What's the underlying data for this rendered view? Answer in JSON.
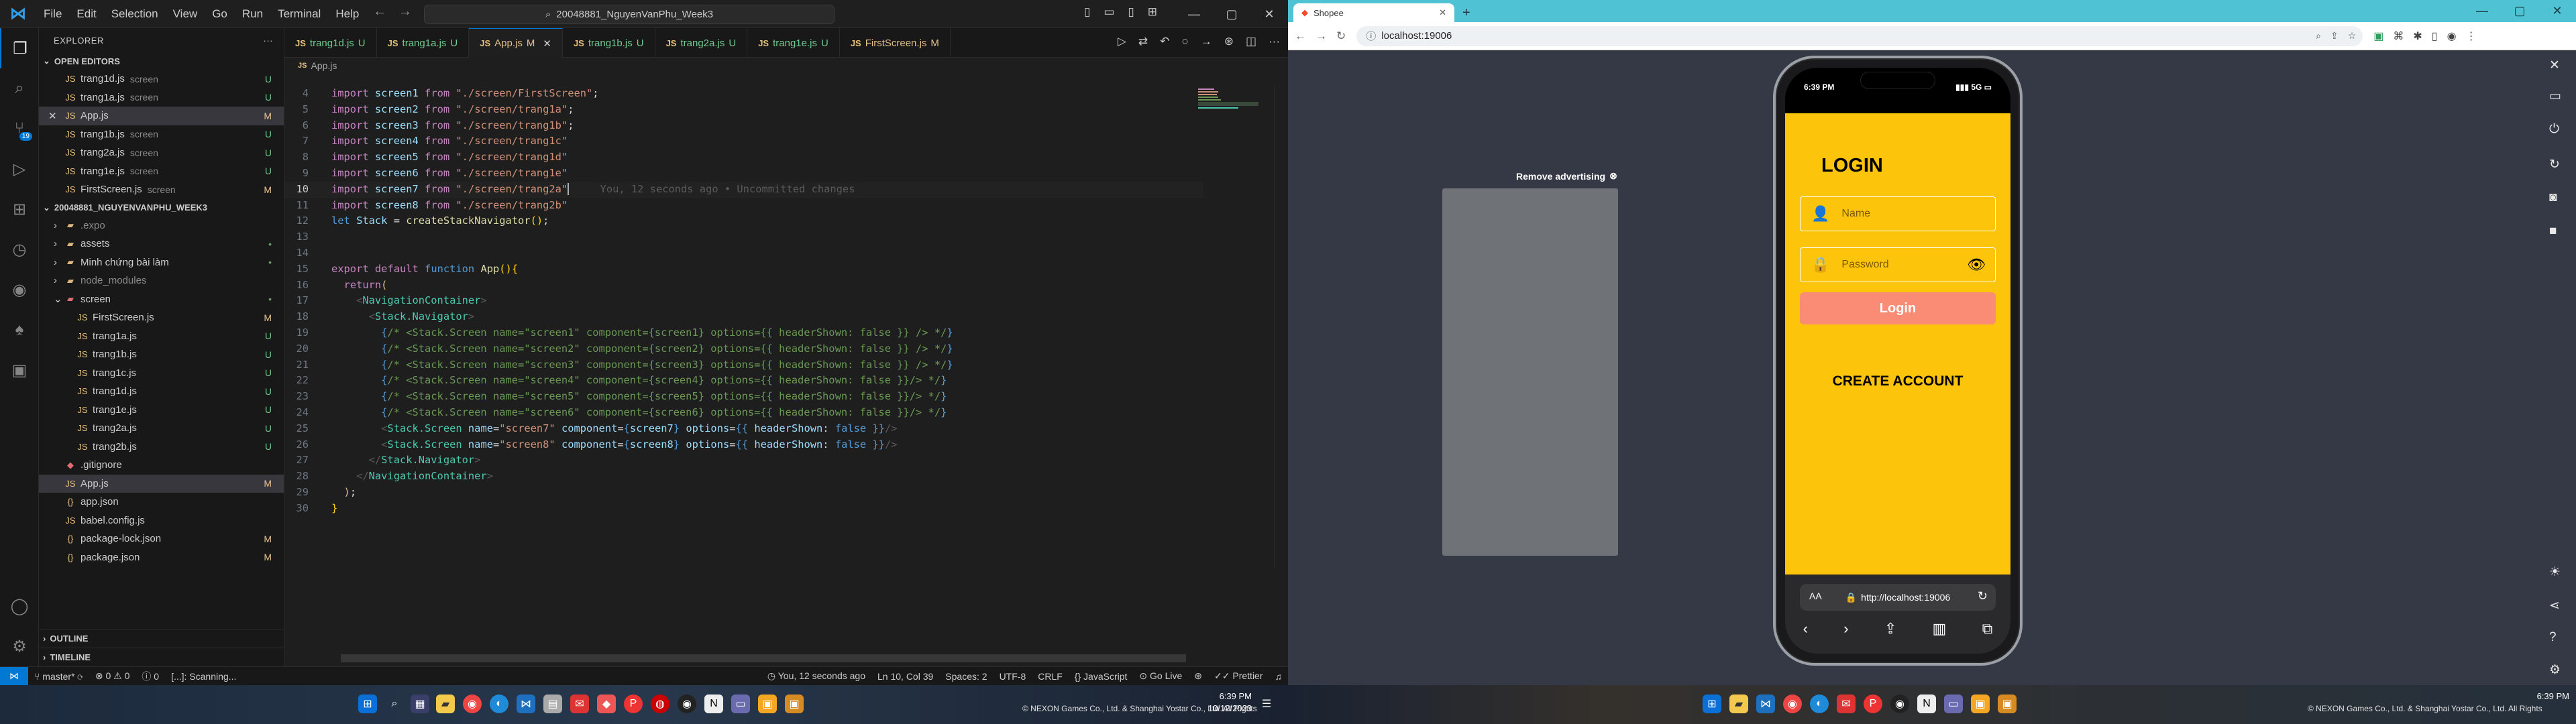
{
  "vscode": {
    "menu": [
      "File",
      "Edit",
      "Selection",
      "View",
      "Go",
      "Run",
      "Terminal",
      "Help"
    ],
    "search_title": "20048881_NguyenVanPhu_Week3",
    "explorer_label": "EXPLORER",
    "open_editors_label": "OPEN EDITORS",
    "open_editors": [
      {
        "name": "trang1d.js",
        "sub": "screen",
        "status": "U"
      },
      {
        "name": "trang1a.js",
        "sub": "screen",
        "status": "U"
      },
      {
        "name": "App.js",
        "sub": "",
        "status": "M"
      },
      {
        "name": "trang1b.js",
        "sub": "screen",
        "status": "U"
      },
      {
        "name": "trang2a.js",
        "sub": "screen",
        "status": "U"
      },
      {
        "name": "trang1e.js",
        "sub": "screen",
        "status": "U"
      },
      {
        "name": "FirstScreen.js",
        "sub": "screen",
        "status": "M"
      }
    ],
    "project_label": "20048881_NGUYENVANPHU_WEEK3",
    "tree": [
      {
        "name": ".expo",
        "type": "folder",
        "status": ""
      },
      {
        "name": "assets",
        "type": "folder",
        "status": "•"
      },
      {
        "name": "Minh chứng bài làm",
        "type": "folder",
        "status": "•"
      },
      {
        "name": "node_modules",
        "type": "folder",
        "status": ""
      },
      {
        "name": "screen",
        "type": "folder-open",
        "status": "•"
      },
      {
        "name": "FirstScreen.js",
        "type": "js",
        "status": "M"
      },
      {
        "name": "trang1a.js",
        "type": "js",
        "status": "U"
      },
      {
        "name": "trang1b.js",
        "type": "js",
        "status": "U"
      },
      {
        "name": "trang1c.js",
        "type": "js",
        "status": "U"
      },
      {
        "name": "trang1d.js",
        "type": "js",
        "status": "U"
      },
      {
        "name": "trang1e.js",
        "type": "js",
        "status": "U"
      },
      {
        "name": "trang2a.js",
        "type": "js",
        "status": "U"
      },
      {
        "name": "trang2b.js",
        "type": "js",
        "status": "U"
      },
      {
        "name": ".gitignore",
        "type": "git",
        "status": ""
      },
      {
        "name": "App.js",
        "type": "js",
        "status": "M"
      },
      {
        "name": "app.json",
        "type": "json",
        "status": ""
      },
      {
        "name": "babel.config.js",
        "type": "js",
        "status": ""
      },
      {
        "name": "package-lock.json",
        "type": "json",
        "status": "M"
      },
      {
        "name": "package.json",
        "type": "json",
        "status": "M"
      }
    ],
    "outline_label": "OUTLINE",
    "timeline_label": "TIMELINE",
    "tabs": [
      {
        "name": "trang1d.js",
        "status": "U"
      },
      {
        "name": "trang1a.js",
        "status": "U"
      },
      {
        "name": "App.js",
        "status": "M"
      },
      {
        "name": "trang1b.js",
        "status": "U"
      },
      {
        "name": "trang2a.js",
        "status": "U"
      },
      {
        "name": "trang1e.js",
        "status": "U"
      },
      {
        "name": "FirstScreen.js",
        "status": "M"
      }
    ],
    "breadcrumb": "App.js",
    "blame": "You, 12 seconds ago • Uncommitted changes",
    "status": {
      "branch": "master*",
      "errors": "0",
      "warnings": "0",
      "info": "0",
      "scanning": "[...]: Scanning...",
      "blame": "You, 12 seconds ago",
      "position": "Ln 10, Col 39",
      "spaces": "Spaces: 2",
      "encoding": "UTF-8",
      "eol": "CRLF",
      "language": "JavaScript",
      "golive": "Go Live",
      "prettier": "Prettier"
    }
  },
  "browser": {
    "tab_title": "Shopee",
    "url": "localhost:19006",
    "remove_ad": "Remove advertising",
    "phone": {
      "time": "6:39 PM",
      "signal": "5G",
      "login_title": "LOGIN",
      "name_placeholder": "Name",
      "password_placeholder": "Password",
      "login_button": "Login",
      "create_account": "CREATE ACCOUNT",
      "safari_url": "http://localhost:19006",
      "safari_aa": "AA"
    },
    "emulator_copyright": "© NEXON Games Co., Ltd. & Shanghai Yostar Co., Ltd. All Rights"
  },
  "taskbar": {
    "time": "6:39 PM",
    "date": "10/12/2023",
    "copyright_left": "© NEXON Games Co., Ltd. & Shanghai Yostar Co., Ltd. All Rights",
    "lang": "ENG"
  }
}
